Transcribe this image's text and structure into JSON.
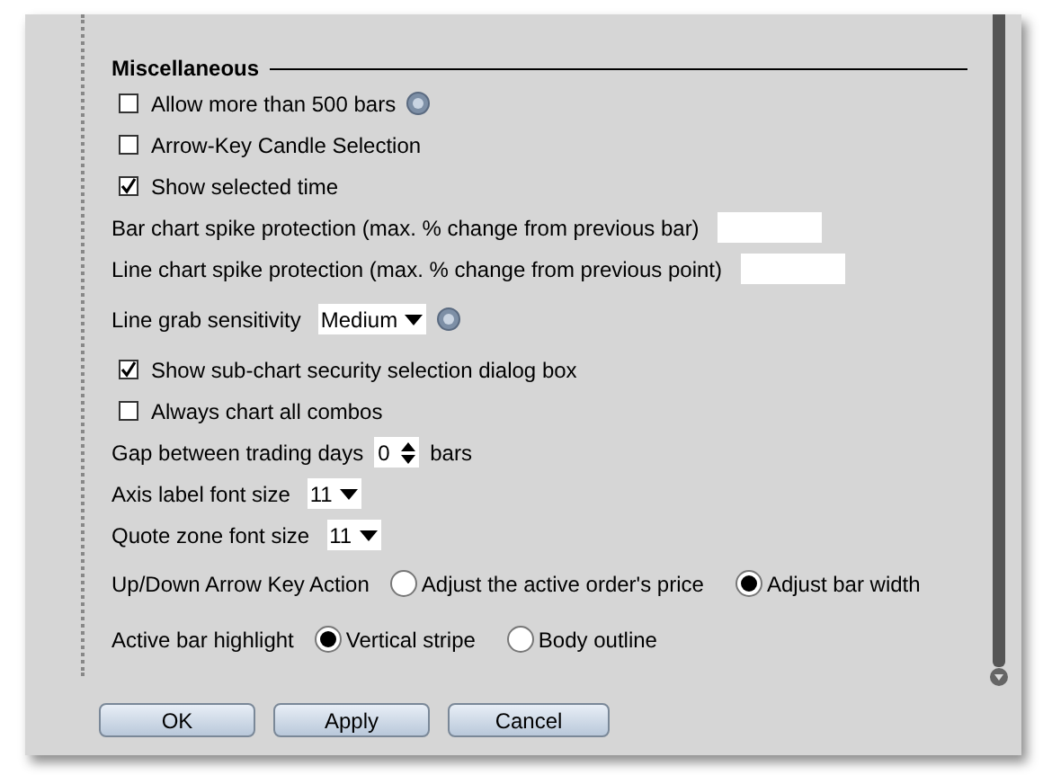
{
  "section": {
    "title": "Miscellaneous"
  },
  "rows": [
    {
      "kind": "checkbox",
      "label": "Allow more than 500 bars",
      "checked": false,
      "help": true
    },
    {
      "kind": "checkbox",
      "label": "Arrow-Key Candle Selection",
      "checked": false
    },
    {
      "kind": "checkbox",
      "label": "Show selected time",
      "checked": true
    },
    {
      "kind": "input",
      "label": "Bar chart spike protection (max. % change from previous bar)"
    },
    {
      "kind": "input",
      "label": "Line chart spike protection (max. % change from previous point)"
    },
    {
      "kind": "dropdown",
      "label": "Line grab sensitivity",
      "value": "Medium",
      "help": true
    },
    {
      "kind": "checkbox",
      "label": "Show sub-chart security selection dialog box",
      "checked": true
    },
    {
      "kind": "checkbox",
      "label": "Always chart all combos",
      "checked": false
    },
    {
      "kind": "spinner",
      "label": "Gap between trading days",
      "value": "0",
      "suffix": "bars"
    },
    {
      "kind": "dropdown",
      "label": "Axis label font size",
      "value": "11"
    },
    {
      "kind": "dropdown",
      "label": "Quote zone font size",
      "value": "11"
    },
    {
      "kind": "radio",
      "label": "Up/Down Arrow Key Action",
      "options": [
        {
          "label": "Adjust the active order's price",
          "selected": false
        },
        {
          "label": "Adjust bar width",
          "selected": true
        }
      ]
    },
    {
      "kind": "radio",
      "label": "Active bar highlight",
      "options": [
        {
          "label": "Vertical stripe",
          "selected": true
        },
        {
          "label": "Body outline",
          "selected": false
        }
      ]
    }
  ],
  "buttons": [
    "OK",
    "Apply",
    "Cancel"
  ]
}
